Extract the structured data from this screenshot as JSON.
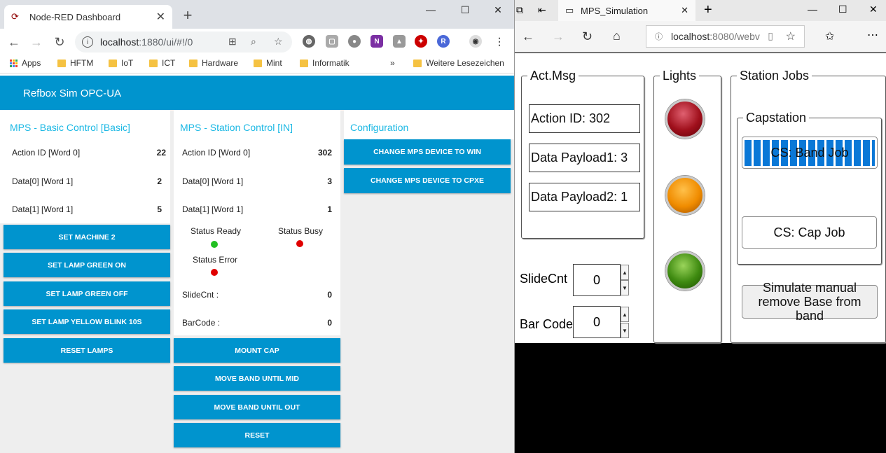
{
  "chrome": {
    "tab_title": "Node-RED Dashboard",
    "url_host": "localhost",
    "url_path": ":1880/ui/#!/0",
    "bookmarks": [
      "Apps",
      "HFTM",
      "IoT",
      "ICT",
      "Hardware",
      "Mint",
      "Informatik",
      "Weitere Lesezeichen"
    ],
    "overflow": "»"
  },
  "dashboard": {
    "header": "Refbox Sim OPC-UA",
    "basic": {
      "title": "MPS - Basic Control [Basic]",
      "rows": [
        {
          "label": "Action ID [Word 0]",
          "value": "22"
        },
        {
          "label": "Data[0] [Word 1]",
          "value": "2"
        },
        {
          "label": "Data[1] [Word 1]",
          "value": "5"
        }
      ],
      "buttons": [
        "SET MACHINE 2",
        "SET LAMP GREEN ON",
        "SET LAMP GREEN OFF",
        "SET LAMP YELLOW BLINK 10S",
        "RESET LAMPS"
      ]
    },
    "station": {
      "title": "MPS - Station Control [IN]",
      "rows": [
        {
          "label": "Action ID [Word 0]",
          "value": "302"
        },
        {
          "label": "Data[0] [Word 1]",
          "value": "3"
        },
        {
          "label": "Data[1] [Word 1]",
          "value": "1"
        }
      ],
      "status_ready": "Status Ready",
      "status_busy": "Status Busy",
      "status_error": "Status Error",
      "ready_color": "#22c022",
      "busy_color": "#e00000",
      "error_color": "#e00000",
      "slidecnt_label": "SlideCnt :",
      "slidecnt_value": "0",
      "barcode_label": "BarCode :",
      "barcode_value": "0",
      "buttons": [
        "MOUNT CAP",
        "MOVE BAND UNTIL MID",
        "MOVE BAND UNTIL OUT",
        "RESET"
      ]
    },
    "config": {
      "title": "Configuration",
      "buttons": [
        "CHANGE MPS DEVICE TO WIN",
        "CHANGE MPS DEVICE TO CPXE"
      ]
    },
    "accent": "#0094ce",
    "title_color": "#1bb8e4"
  },
  "edge": {
    "tab_title": "MPS_Simulation",
    "url_host": "localhost",
    "url_path": ":8080/webv"
  },
  "sim": {
    "actmsg": {
      "legend": "Act.Msg",
      "action_id": "Action ID: 302",
      "payload1": "Data Payload1: 3",
      "payload2": "Data Payload2: 1"
    },
    "lights": {
      "legend": "Lights",
      "colors": [
        "red",
        "yellow",
        "green"
      ]
    },
    "jobs": {
      "legend": "Station Jobs",
      "capstation": "Capstation",
      "band_job": "CS: Band Job",
      "cap_job": "CS: Cap Job",
      "simulate": "Simulate manual remove Base from band",
      "band_progress": 1.0
    },
    "slidecnt_label": "SlideCnt",
    "slidecnt_value": "0",
    "barcode_label": "Bar Code",
    "barcode_value": "0"
  }
}
